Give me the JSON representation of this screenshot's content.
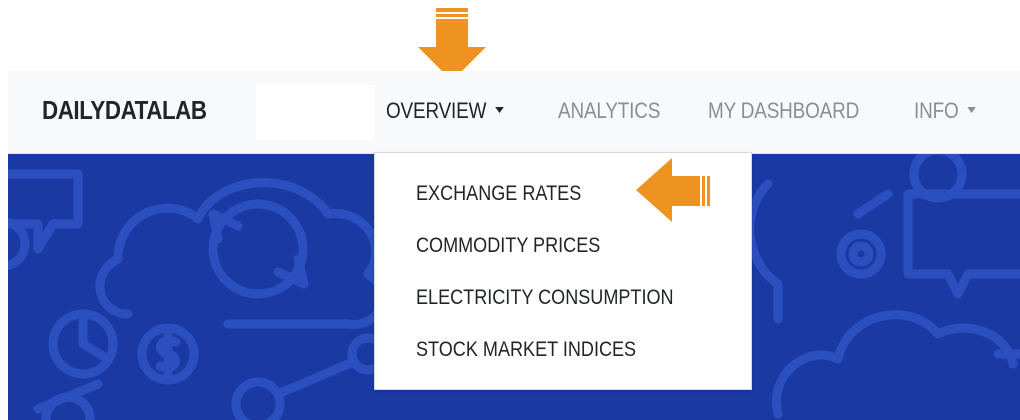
{
  "brand": {
    "name": "DAILYDATALAB"
  },
  "nav": {
    "items": [
      {
        "label": "OVERVIEW",
        "active": true,
        "has_caret": true
      },
      {
        "label": "ANALYTICS",
        "active": false,
        "has_caret": false
      },
      {
        "label": "MY DASHBOARD",
        "active": false,
        "has_caret": false
      },
      {
        "label": "INFO",
        "active": false,
        "has_caret": true
      }
    ]
  },
  "dropdown": {
    "items": [
      {
        "label": "EXCHANGE RATES"
      },
      {
        "label": "COMMODITY PRICES"
      },
      {
        "label": "ELECTRICITY CONSUMPTION"
      },
      {
        "label": "STOCK MARKET INDICES"
      }
    ]
  },
  "icons": {
    "overview_caret": "caret-down-icon",
    "info_caret": "caret-down-icon",
    "pointer_down": "arrow-down-icon",
    "pointer_left": "arrow-left-icon",
    "hero_pattern": "cloud-gear-dollar-pattern"
  },
  "colors": {
    "navbar_bg": "#f8f9fa",
    "hero_bg": "#1a39a3",
    "hero_line": "#2c4fc0",
    "arrow": "#ef9320",
    "text_dark": "#212529",
    "text_muted": "#8a8f94"
  }
}
